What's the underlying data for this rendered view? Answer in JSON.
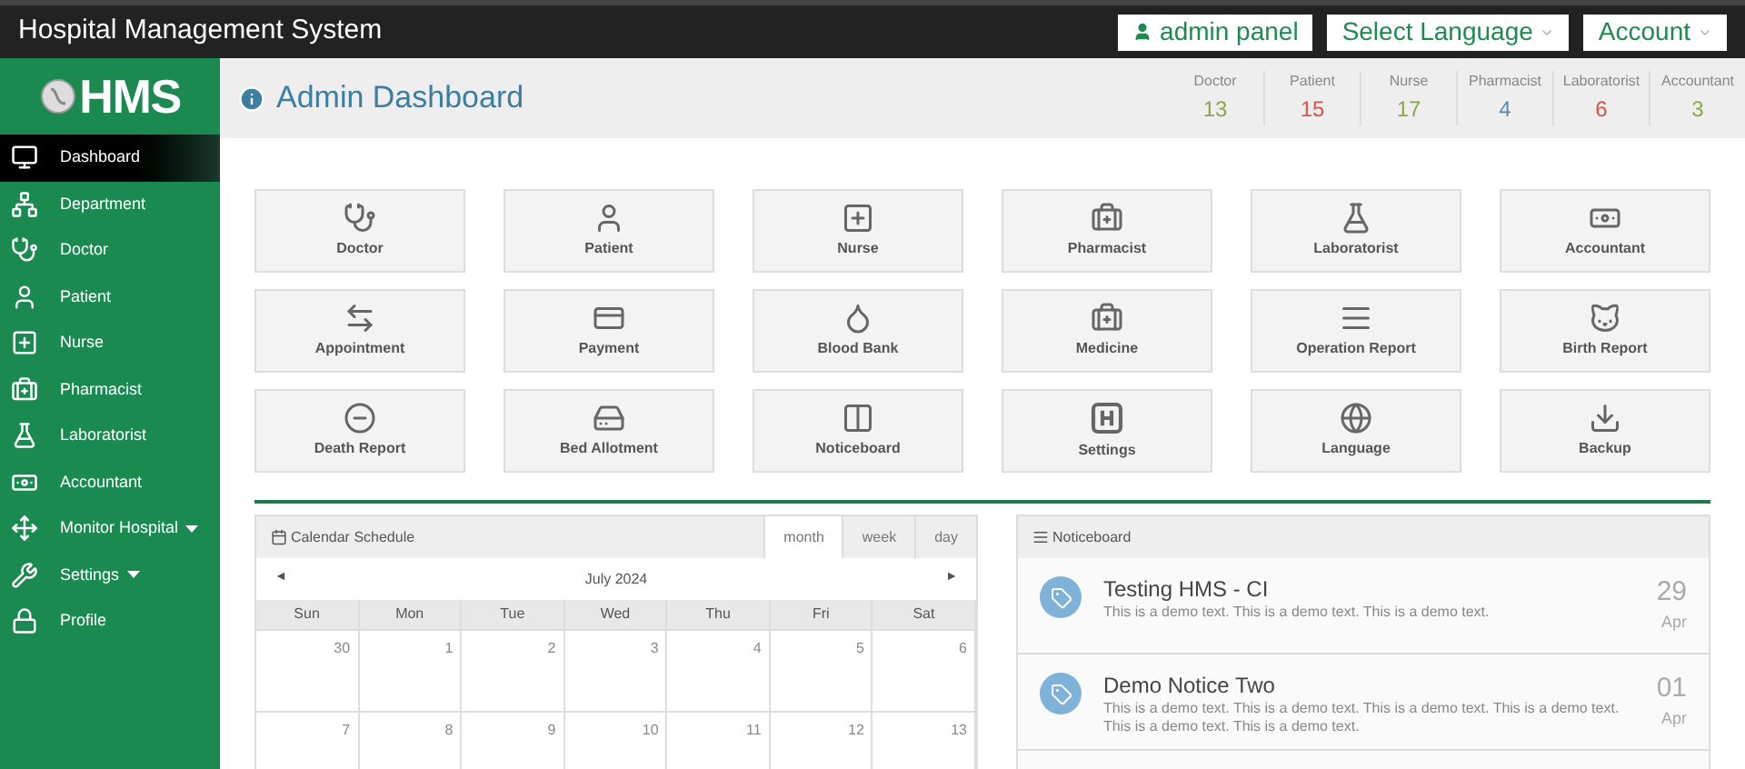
{
  "topbar": {
    "title": "Hospital Management System",
    "buttons": [
      {
        "label": "admin panel",
        "kind": "user"
      },
      {
        "label": "Select Language",
        "kind": "dropdown"
      },
      {
        "label": "Account",
        "kind": "dropdown"
      }
    ]
  },
  "sidebar": {
    "logo": "HMS",
    "items": [
      {
        "label": "Dashboard",
        "selected": true,
        "submenu": false
      },
      {
        "label": "Department",
        "selected": false,
        "submenu": false
      },
      {
        "label": "Doctor",
        "selected": false,
        "submenu": false
      },
      {
        "label": "Patient",
        "selected": false,
        "submenu": false
      },
      {
        "label": "Nurse",
        "selected": false,
        "submenu": false
      },
      {
        "label": "Pharmacist",
        "selected": false,
        "submenu": false
      },
      {
        "label": "Laboratorist",
        "selected": false,
        "submenu": false
      },
      {
        "label": "Accountant",
        "selected": false,
        "submenu": false
      },
      {
        "label": "Monitor Hospital",
        "selected": false,
        "submenu": true
      },
      {
        "label": "Settings",
        "selected": false,
        "submenu": true
      },
      {
        "label": "Profile",
        "selected": false,
        "submenu": false
      }
    ]
  },
  "header": {
    "title": "Admin Dashboard",
    "stats": [
      {
        "label": "Doctor",
        "value": "13",
        "color": "#8aa84a"
      },
      {
        "label": "Patient",
        "value": "15",
        "color": "#d9534f"
      },
      {
        "label": "Nurse",
        "value": "17",
        "color": "#8aa84a"
      },
      {
        "label": "Pharmacist",
        "value": "4",
        "color": "#5b8ab5"
      },
      {
        "label": "Laboratorist",
        "value": "6",
        "color": "#d9534f"
      },
      {
        "label": "Accountant",
        "value": "3",
        "color": "#8aa84a"
      }
    ]
  },
  "tiles": [
    "Doctor",
    "Patient",
    "Nurse",
    "Pharmacist",
    "Laboratorist",
    "Accountant",
    "Appointment",
    "Payment",
    "Blood Bank",
    "Medicine",
    "Operation Report",
    "Birth Report",
    "Death Report",
    "Bed Allotment",
    "Noticeboard",
    "Settings",
    "Language",
    "Backup"
  ],
  "calendar": {
    "title": "Calendar Schedule",
    "views": [
      {
        "label": "month",
        "selected": true
      },
      {
        "label": "week",
        "selected": false
      },
      {
        "label": "day",
        "selected": false
      }
    ],
    "prev": "◄",
    "month": "July 2024",
    "next": "►",
    "weekdays": [
      "Sun",
      "Mon",
      "Tue",
      "Wed",
      "Thu",
      "Fri",
      "Sat"
    ],
    "weeks": [
      [
        "30",
        "1",
        "2",
        "3",
        "4",
        "5",
        "6"
      ],
      [
        "7",
        "8",
        "9",
        "10",
        "11",
        "12",
        "13"
      ]
    ]
  },
  "noticeboard": {
    "title": "Noticeboard",
    "notices": [
      {
        "title": "Testing HMS - CI",
        "text": "This is a demo text. This is a demo text. This is a demo text.",
        "day": "29",
        "month": "Apr"
      },
      {
        "title": "Demo Notice Two",
        "text": "This is a demo text. This is a demo text. This is a demo text. This is a demo text. This is a demo text. This is a demo text.",
        "day": "01",
        "month": "Apr"
      }
    ]
  }
}
